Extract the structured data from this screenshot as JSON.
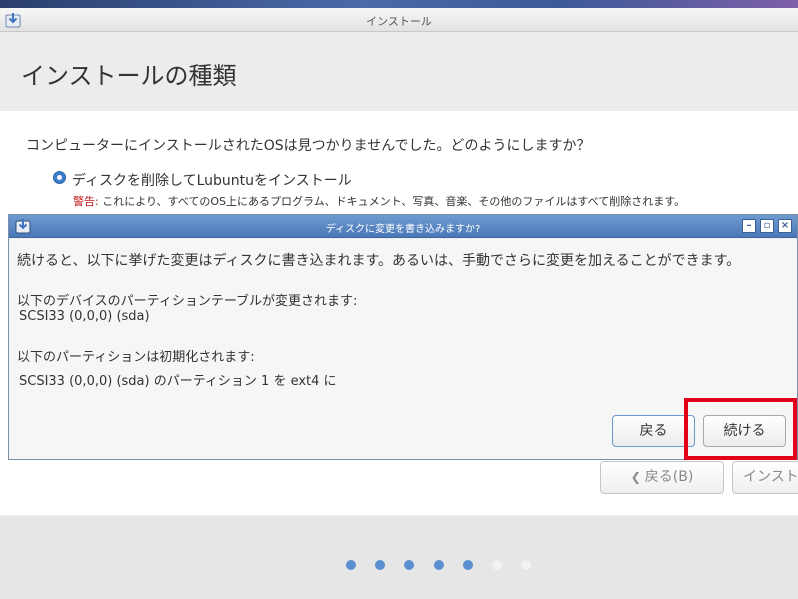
{
  "window": {
    "title": "インストール"
  },
  "page": {
    "title": "インストールの種類",
    "question": "コンピューターにインストールされたOSは見つかりませんでした。どのようにしますか？",
    "option_label": "ディスクを削除してLubuntuをインストール",
    "warning_label": "警告:",
    "warning_text": " これにより、すべてのOS上にあるプログラム、ドキュメント、写真、音楽、その他のファイルはすべて削除されます。"
  },
  "dialog": {
    "title": "ディスクに変更を書き込みますか?",
    "intro": "続けると、以下に挙げた変更はディスクに書き込まれます。あるいは、手動でさらに変更を加えることができます。",
    "partition_table_heading": "以下のデバイスのパーティションテーブルが変更されます:",
    "partition_table_device": "SCSI33 (0,0,0) (sda)",
    "format_heading": "以下のパーティションは初期化されます:",
    "format_item": "SCSI33 (0,0,0) (sda) のパーティション 1 を ext4 に",
    "back_label": "戻る",
    "continue_label": "続ける",
    "window_controls": [
      "minimize-icon",
      "maximize-icon",
      "close-icon"
    ]
  },
  "footer": {
    "back_label": "戻る(B)",
    "install_label": "インストール"
  },
  "progress": {
    "total_steps": 7,
    "completed_steps": 5,
    "active_color": "#5b8fd0",
    "inactive_color": "#f2f2f2"
  },
  "colors": {
    "accent": "#3d7dca",
    "warning": "#c01818",
    "highlight": "#e2001a"
  }
}
